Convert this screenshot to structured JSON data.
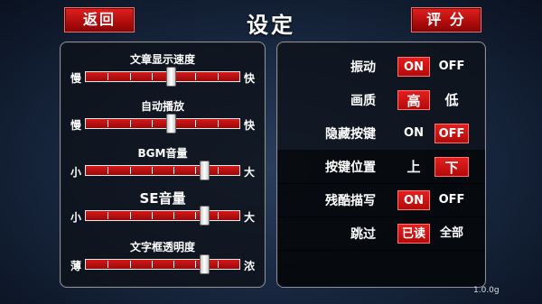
{
  "header": {
    "back_label": "返回",
    "title": "设定",
    "rate_label": "评 分"
  },
  "sliders": [
    {
      "label": "文章显示速度",
      "min_label": "慢",
      "max_label": "快",
      "value": 0.55
    },
    {
      "label": "自动播放",
      "min_label": "慢",
      "max_label": "快",
      "value": 0.55
    },
    {
      "label": "BGM音量",
      "min_label": "小",
      "max_label": "大",
      "value": 0.77
    },
    {
      "label": "SE音量",
      "min_label": "小",
      "max_label": "大",
      "value": 0.77
    },
    {
      "label": "文字框透明度",
      "min_label": "薄",
      "max_label": "浓",
      "value": 0.77
    }
  ],
  "settings": [
    {
      "label": "振动",
      "options": [
        "ON",
        "OFF"
      ],
      "selected": 0
    },
    {
      "label": "画质",
      "options": [
        "高",
        "低"
      ],
      "selected": 0
    },
    {
      "label": "隐藏按键",
      "options": [
        "ON",
        "OFF"
      ],
      "selected": 1
    },
    {
      "label": "按键位置",
      "options": [
        "上",
        "下"
      ],
      "selected": 1
    },
    {
      "label": "残酷描写",
      "options": [
        "ON",
        "OFF"
      ],
      "selected": 0
    },
    {
      "label": "跳过",
      "options": [
        "已读",
        "全部"
      ],
      "selected": 0
    }
  ],
  "version": "1.0.0g",
  "colors": {
    "accent": "#c01010",
    "panel_border": "#8a8f99",
    "background": "#1a2a44"
  }
}
